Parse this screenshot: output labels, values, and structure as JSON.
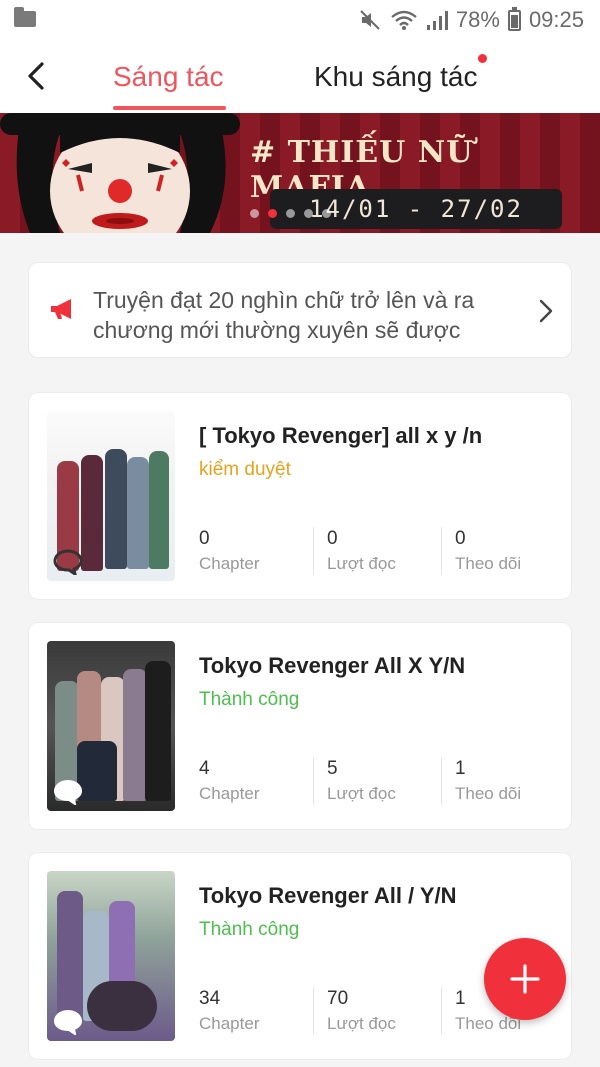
{
  "status_bar": {
    "battery": "78%",
    "time": "09:25",
    "icons": [
      "folder-icon",
      "mute-icon",
      "wifi-icon",
      "signal-icon",
      "battery-icon"
    ]
  },
  "header": {
    "tabs": [
      {
        "label": "Sáng tác",
        "active": true
      },
      {
        "label": "Khu sáng tác",
        "active": false,
        "has_notification_dot": true
      }
    ]
  },
  "banner": {
    "title": "# THIẾU NỮ MAFIA",
    "date_range": "14/01 - 27/02",
    "carousel_total": 5,
    "carousel_active_index": 1
  },
  "notice": {
    "text": "Truyện đạt 20 nghìn chữ trở lên và ra chương mới thường xuyên sẽ được"
  },
  "stories": [
    {
      "title": "[ Tokyo Revenger] all x y /n",
      "status": "kiểm duyệt",
      "status_color": "#e8a11c",
      "stats": [
        {
          "value": "0",
          "label": "Chapter"
        },
        {
          "value": "0",
          "label": "Lượt đọc"
        },
        {
          "value": "0",
          "label": "Theo dõi"
        }
      ]
    },
    {
      "title": "Tokyo Revenger All X Y/N",
      "status": "Thành công",
      "status_color": "#4cbf4c",
      "stats": [
        {
          "value": "4",
          "label": "Chapter"
        },
        {
          "value": "5",
          "label": "Lượt đọc"
        },
        {
          "value": "1",
          "label": "Theo dõi"
        }
      ]
    },
    {
      "title": "Tokyo Revenger All / Y/N",
      "status": "Thành công",
      "status_color": "#4cbf4c",
      "stats": [
        {
          "value": "34",
          "label": "Chapter"
        },
        {
          "value": "70",
          "label": "Lượt đọc"
        },
        {
          "value": "1",
          "label": "Theo dõi"
        }
      ]
    }
  ],
  "colors": {
    "accent": "#f0555e",
    "fab": "#f0303b",
    "banner_bg": "#7d1620"
  }
}
